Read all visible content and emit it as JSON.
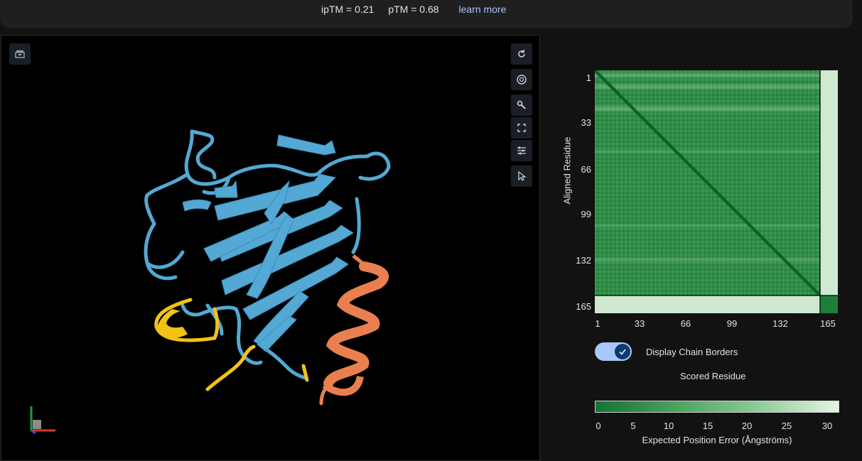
{
  "header": {
    "iptm": "ipTM = 0.21",
    "ptm": "pTM = 0.68",
    "learn_more": "learn more"
  },
  "viewer": {
    "left_button_icon": "save-view-icon",
    "tool_icons": [
      "reset-rotation-icon",
      "camera-icon",
      "wrench-icon",
      "fullscreen-icon",
      "settings-sliders-icon",
      "cursor-icon"
    ],
    "chain_colors": {
      "chain_a": "#53a9d4",
      "chain_b": "#e97f4f",
      "highlight": "#f2c316"
    }
  },
  "pae": {
    "y_axis_label": "Aligned Residue",
    "x_axis_label": "Scored Residue",
    "ticks": [
      "1",
      "33",
      "66",
      "99",
      "132",
      "165"
    ],
    "chain_break_residue": 155,
    "total_residues": 165,
    "display_chain_borders": {
      "label": "Display Chain Borders",
      "checked": true
    },
    "colorbar": {
      "ticks": [
        "0",
        "5",
        "10",
        "15",
        "20",
        "25",
        "30"
      ],
      "label": "Expected Position Error (Ångströms)",
      "min": 0,
      "max": 30,
      "color_low": "#137333",
      "color_high": "#e6f4e3"
    }
  }
}
